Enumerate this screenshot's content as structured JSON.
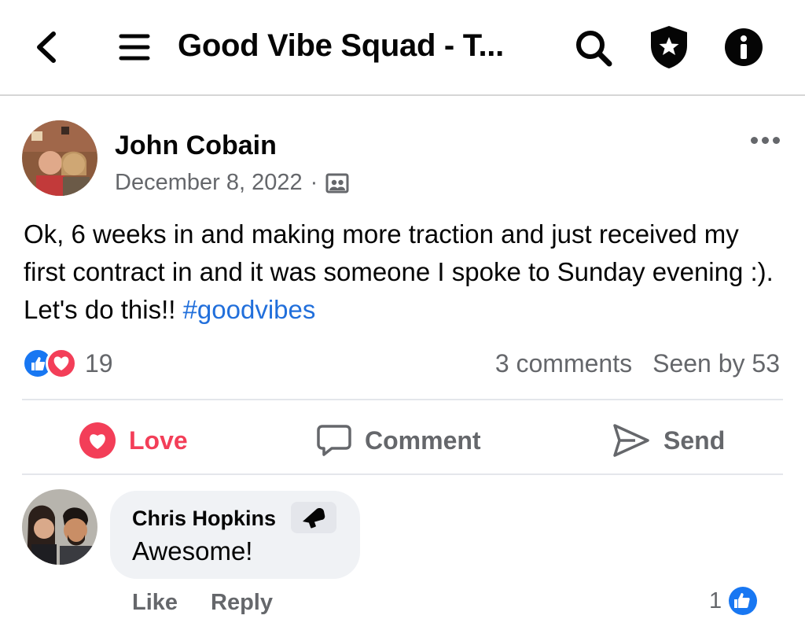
{
  "header": {
    "title": "Good Vibe Squad - T...",
    "icons": [
      "back-arrow-icon",
      "menu-icon",
      "search-icon",
      "admin-shield-icon",
      "info-icon"
    ]
  },
  "post": {
    "author": "John Cobain",
    "date": "December 8, 2022",
    "separator": "·",
    "audience_icon": "group-members-icon",
    "text_main": "Ok, 6 weeks in and making more traction and just received my first contract in and it was someone I spoke to Sunday evening :).  Let's do this!! ",
    "hashtag": "#goodvibes",
    "reaction_icons": [
      "like-reaction-icon",
      "love-reaction-icon"
    ],
    "reaction_count": "19",
    "comments_count": "3 comments",
    "seen_by": "Seen by 53"
  },
  "actions": {
    "love_label": "Love",
    "comment_label": "Comment",
    "send_label": "Send"
  },
  "comment": {
    "author": "Chris Hopkins",
    "badge_icon": "rising-star-badge-icon",
    "text": "Awesome!",
    "like_label": "Like",
    "reply_label": "Reply",
    "like_count": "1"
  },
  "colors": {
    "like_blue": "#1877f2",
    "love_red": "#f33e58",
    "hashtag_blue": "#216fdb",
    "muted": "#65676b"
  }
}
